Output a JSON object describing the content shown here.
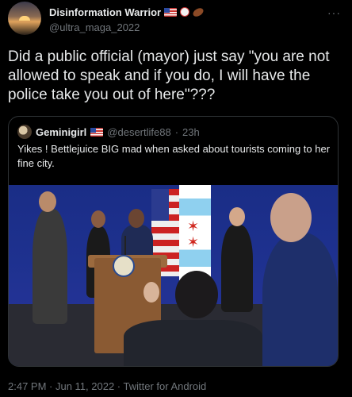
{
  "tweet": {
    "author": {
      "display_name": "Disinformation Warrior",
      "handle": "@ultra_maga_2022",
      "badges": [
        "us-flag-icon",
        "baseball-icon",
        "football-icon"
      ]
    },
    "text": "Did a public official (mayor) just say \"you are not allowed to speak and if you do, I will have the police take you out of here\"???",
    "timestamp": "2:47 PM · Jun 11, 2022 · Twitter for Android",
    "more_icon": "more-horizontal-icon"
  },
  "quoted_tweet": {
    "display_name": "Geminigirl",
    "badge": "us-flag-icon",
    "handle": "@desertlife88",
    "separator": "·",
    "time": "23h",
    "text": "Yikes ! Bettlejuice BIG mad when asked about tourists coming to her fine city.",
    "media": "press-conference-video-still"
  },
  "colors": {
    "background": "#000000",
    "text_primary": "#e7e9ea",
    "text_secondary": "#71767b",
    "border": "#2f3336"
  }
}
